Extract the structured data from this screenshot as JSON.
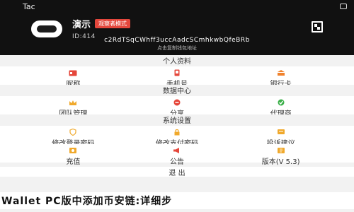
{
  "status_bar": {
    "app_name": "Tac"
  },
  "profile": {
    "name": "演示",
    "mode_badge": "观察者模式",
    "id_label": "ID:414"
  },
  "wallet": {
    "address": "c2RdTSqCWhff3uccAadcSCmhkwbQfeBRb",
    "address_hint": "点击复制钱包地址"
  },
  "sections": [
    {
      "title": "个人资料",
      "items": [
        {
          "label": "昵称",
          "icon": "id-card-icon",
          "color": "#e5473b"
        },
        {
          "label": "手机号",
          "icon": "phone-icon",
          "color": "#e5473b"
        },
        {
          "label": "银行卡",
          "icon": "bank-card-icon",
          "color": "#f0822c"
        }
      ]
    },
    {
      "title": "数据中心",
      "items": [
        {
          "label": "团队管理",
          "icon": "crown-icon",
          "color": "#f0a92c"
        },
        {
          "label": "分享",
          "icon": "share-icon",
          "color": "#e5473b"
        },
        {
          "label": "代理商",
          "icon": "agent-check-icon",
          "color": "#3cb04a"
        }
      ]
    },
    {
      "title": "系统设置",
      "items": [
        {
          "label": "修改登录密码",
          "icon": "shield-icon",
          "color": "#f0a92c"
        },
        {
          "label": "修改支付密码",
          "icon": "lock-icon",
          "color": "#f0a92c"
        },
        {
          "label": "投诉建议",
          "icon": "feedback-icon",
          "color": "#f0a92c"
        },
        {
          "label": "充值",
          "icon": "deposit-icon",
          "color": "#f0a92c"
        },
        {
          "label": "公告",
          "icon": "announcement-icon",
          "color": "#e5473b"
        },
        {
          "label": "版本(V 5.3)",
          "icon": "version-icon",
          "color": "#f0a92c"
        }
      ]
    }
  ],
  "logout_label": "退 出",
  "banner_text": "Wallet PC版中添加币安链:详细步"
}
